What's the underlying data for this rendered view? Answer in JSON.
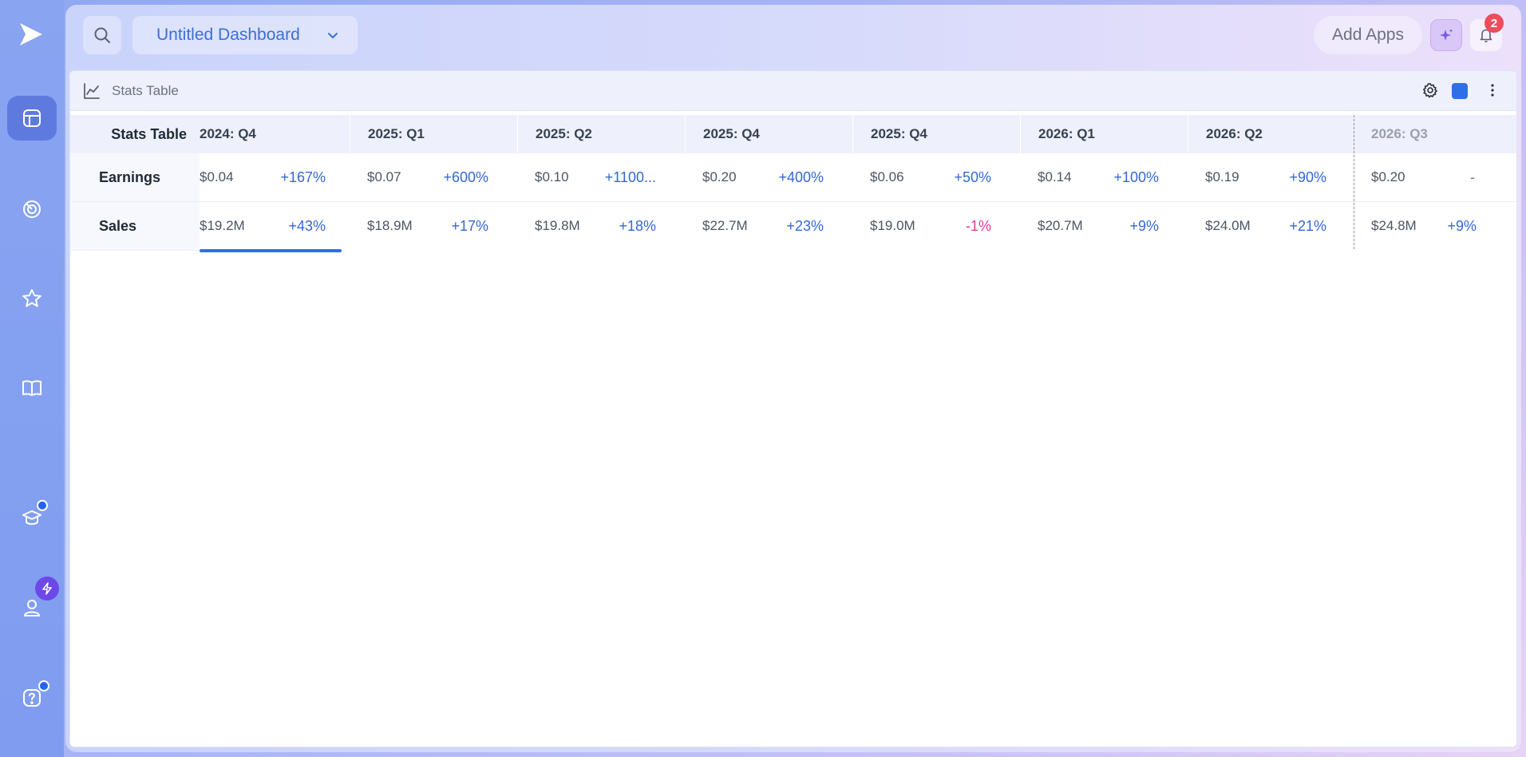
{
  "header": {
    "dashboard_name": "Untitled Dashboard",
    "add_apps_label": "Add Apps",
    "notification_count": "2"
  },
  "sidebar": {
    "items": [
      {
        "icon": "dashboard-icon",
        "active": true
      },
      {
        "icon": "radar-icon",
        "active": false
      },
      {
        "icon": "star-icon",
        "active": false
      },
      {
        "icon": "book-icon",
        "active": false
      },
      {
        "icon": "graduation-cap-icon",
        "active": false
      },
      {
        "icon": "user-icon",
        "active": false
      },
      {
        "icon": "help-icon",
        "active": false
      }
    ]
  },
  "widget": {
    "title": "Stats Table",
    "accent_color": "#2f6fe6"
  },
  "table": {
    "corner_label": "Stats Table",
    "columns": [
      "2024: Q4",
      "2025: Q1",
      "2025: Q2",
      "2025: Q4",
      "2025: Q4",
      "2026: Q1",
      "2026: Q2",
      "2026: Q3"
    ],
    "rows": [
      {
        "label": "Earnings",
        "values": [
          "$0.04",
          "$0.07",
          "$0.10",
          "$0.20",
          "$0.06",
          "$0.14",
          "$0.19",
          "$0.20"
        ],
        "changes": [
          "+167%",
          "+600%",
          "+1100...",
          "+400%",
          "+50%",
          "+100%",
          "+90%",
          "-"
        ]
      },
      {
        "label": "Sales",
        "values": [
          "$19.2M",
          "$18.9M",
          "$19.8M",
          "$22.7M",
          "$19.0M",
          "$20.7M",
          "$24.0M",
          "$24.8M"
        ],
        "changes": [
          "+43%",
          "+17%",
          "+18%",
          "+23%",
          "-1%",
          "+9%",
          "+21%",
          "+9%"
        ]
      }
    ]
  },
  "colors": {
    "positive": "#3567d6",
    "negative": "#e0399e",
    "badge": "#ef4b5b"
  }
}
